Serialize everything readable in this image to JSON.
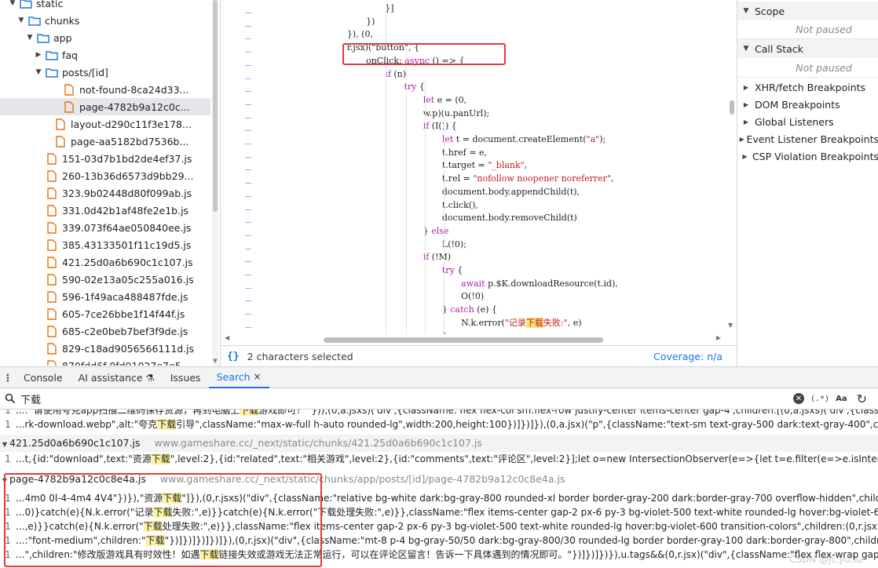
{
  "file_tree": {
    "items": [
      {
        "label": "static",
        "type": "folder",
        "expanded": true,
        "depth": 3
      },
      {
        "label": "chunks",
        "type": "folder",
        "expanded": true,
        "depth": 4
      },
      {
        "label": "app",
        "type": "folder",
        "expanded": true,
        "depth": 5
      },
      {
        "label": "faq",
        "type": "folder",
        "expanded": false,
        "depth": 6
      },
      {
        "label": "posts/[id]",
        "type": "folder",
        "expanded": true,
        "depth": 6
      },
      {
        "label": "not-found-8ca24d33...",
        "type": "file",
        "depth": 8
      },
      {
        "label": "page-4782b9a12c0c...",
        "type": "file",
        "depth": 8,
        "selected": true
      },
      {
        "label": "layout-d290c11f3e178...",
        "type": "file",
        "depth": 7
      },
      {
        "label": "page-aa5182bd7536b...",
        "type": "file",
        "depth": 7
      },
      {
        "label": "151-03d7b1bd2de4ef37.js",
        "type": "file",
        "depth": 6
      },
      {
        "label": "260-13b36d6573d9bb29...",
        "type": "file",
        "depth": 6
      },
      {
        "label": "323.9b02448d80f099ab.js",
        "type": "file",
        "depth": 6
      },
      {
        "label": "331.0d42b1af48fe2e1b.js",
        "type": "file",
        "depth": 6
      },
      {
        "label": "339.073f64ae050840ee.js",
        "type": "file",
        "depth": 6
      },
      {
        "label": "385.43133501f11c19d5.js",
        "type": "file",
        "depth": 6
      },
      {
        "label": "421.25d0a6b690c1c107.js",
        "type": "file",
        "depth": 6
      },
      {
        "label": "590-02e13a05c255a016.js",
        "type": "file",
        "depth": 6
      },
      {
        "label": "596-1f49aca488487fde.js",
        "type": "file",
        "depth": 6
      },
      {
        "label": "605-7ce26bbe1f14f44f.js",
        "type": "file",
        "depth": 6
      },
      {
        "label": "685-c2e0beb7bef3f9de.js",
        "type": "file",
        "depth": 6
      },
      {
        "label": "829-c18ad9056566111d.js",
        "type": "file",
        "depth": 6
      },
      {
        "label": "870fdd6f-0fd91027e7e5...",
        "type": "file",
        "depth": 6
      }
    ]
  },
  "editor": {
    "lines": [
      {
        "indent": 26,
        "tokens": [
          {
            "t": "}]"
          }
        ]
      },
      {
        "indent": 22,
        "tokens": [
          {
            "t": "})"
          }
        ]
      },
      {
        "indent": 18,
        "tokens": [
          {
            "t": "}), (0,"
          }
        ]
      },
      {
        "indent": 18,
        "tokens": [
          {
            "t": "r.jsx)(\"button\", {"
          }
        ]
      },
      {
        "indent": 22,
        "tokens": [
          {
            "t": "onClick: "
          },
          {
            "t": "async",
            "c": "kw"
          },
          {
            "t": " () => {"
          }
        ]
      },
      {
        "indent": 26,
        "tokens": [
          {
            "t": "if",
            "c": "kw"
          },
          {
            "t": " (n)"
          }
        ]
      },
      {
        "indent": 30,
        "tokens": [
          {
            "t": "try",
            "c": "kw"
          },
          {
            "t": " {"
          }
        ]
      },
      {
        "indent": 34,
        "tokens": [
          {
            "t": "let",
            "c": "kw"
          },
          {
            "t": " e = (0,"
          }
        ]
      },
      {
        "indent": 34,
        "tokens": [
          {
            "t": "w.p)(u.panUrl);"
          }
        ]
      },
      {
        "indent": 34,
        "tokens": [
          {
            "t": "if",
            "c": "kw"
          },
          {
            "t": " (I()) {"
          }
        ]
      },
      {
        "indent": 38,
        "tokens": [
          {
            "t": "let",
            "c": "kw"
          },
          {
            "t": " t = document.createElement("
          },
          {
            "t": "\"a\"",
            "c": "str"
          },
          {
            "t": ");"
          }
        ]
      },
      {
        "indent": 38,
        "tokens": [
          {
            "t": "t.href = e,"
          }
        ]
      },
      {
        "indent": 38,
        "tokens": [
          {
            "t": "t.target = "
          },
          {
            "t": "\"_blank\"",
            "c": "str"
          },
          {
            "t": ","
          }
        ]
      },
      {
        "indent": 38,
        "tokens": [
          {
            "t": "t.rel = "
          },
          {
            "t": "\"nofollow noopener noreferrer\"",
            "c": "str"
          },
          {
            "t": ","
          }
        ]
      },
      {
        "indent": 38,
        "tokens": [
          {
            "t": "document.body.appendChild(t),"
          }
        ]
      },
      {
        "indent": 38,
        "tokens": [
          {
            "t": "t.click(),"
          }
        ]
      },
      {
        "indent": 38,
        "tokens": [
          {
            "t": "document.body.removeChild(t)"
          }
        ]
      },
      {
        "indent": 34,
        "tokens": [
          {
            "t": "} "
          },
          {
            "t": "else",
            "c": "kw"
          }
        ]
      },
      {
        "indent": 38,
        "tokens": [
          {
            "t": "L(!0);"
          }
        ]
      },
      {
        "indent": 34,
        "tokens": [
          {
            "t": "if",
            "c": "kw"
          },
          {
            "t": " (!M)"
          }
        ]
      },
      {
        "indent": 38,
        "tokens": [
          {
            "t": "try",
            "c": "kw"
          },
          {
            "t": " {"
          }
        ]
      },
      {
        "indent": 42,
        "tokens": [
          {
            "t": "await",
            "c": "kw"
          },
          {
            "t": " p.$K.downloadResource(t.id),"
          }
        ]
      },
      {
        "indent": 42,
        "tokens": [
          {
            "t": "O(!0)"
          }
        ]
      },
      {
        "indent": 38,
        "tokens": [
          {
            "t": "} "
          },
          {
            "t": "catch",
            "c": "kw"
          },
          {
            "t": " (e) {"
          }
        ]
      },
      {
        "indent": 42,
        "tokens": [
          {
            "t": "N.k.error("
          },
          {
            "t": "\"记录",
            "c": "str"
          },
          {
            "t": "下载",
            "c": "str-hl"
          },
          {
            "t": "失败:\"",
            "c": "str"
          },
          {
            "t": ", e)"
          }
        ]
      },
      {
        "indent": 38,
        "tokens": [
          {
            "t": "}"
          }
        ]
      }
    ],
    "status": {
      "braces": "{}",
      "selection": "2 characters selected",
      "coverage": "Coverage: n/a"
    }
  },
  "debugger": {
    "sections": [
      {
        "label": "Scope",
        "expanded": true,
        "note": "Not paused"
      },
      {
        "label": "Call Stack",
        "expanded": true,
        "note": "Not paused"
      }
    ],
    "items": [
      "XHR/fetch Breakpoints",
      "DOM Breakpoints",
      "Global Listeners",
      "Event Listener Breakpoints",
      "CSP Violation Breakpoints"
    ]
  },
  "drawer": {
    "kebab": "⋮",
    "tabs": [
      {
        "label": "Console",
        "active": false
      },
      {
        "label": "AI assistance ⚗",
        "active": false
      },
      {
        "label": "Issues",
        "active": false
      },
      {
        "label": "Search",
        "active": true,
        "closable": true
      }
    ],
    "close_glyph": "×"
  },
  "search": {
    "query": "下载",
    "regex_label": "(.*)",
    "case_label": "Aa",
    "refresh_glyph": "↻"
  },
  "results": {
    "groups": [
      {
        "file": null,
        "lines": [
          {
            "num": "1",
            "before": "...: '请使用夸克app扫描二维码保存资源，再到电脑上",
            "match": "下载",
            "after": "游戏即可！' })),(0,a.jsxs)('div',{className:'flex flex-col sm:flex-row justify-center items-center gap-4',children:[(0,a.jsxs)('div',{className:'"
          },
          {
            "num": "1",
            "before": "...rk-download.webp\",alt:\"夸克",
            "match": "下载",
            "after": "引导\",className:\"max-w-full h-auto rounded-lg\",width:200,height:100})]})]}),(0,a.jsx)(\"p\",{className:\"text-sm text-gray-500 dark:text-gray-400\",children:\"温馨提"
          }
        ]
      },
      {
        "file": "421.25d0a6b690c1c107.js",
        "url": "www.gameshare.cc/_next/static/chunks/421.25d0a6b690c1c107.js",
        "lines": [
          {
            "num": "1",
            "before": "...t,{id:\"download\",text:\"资源",
            "match": "下载",
            "after": "\",level:2},{id:\"related\",text:\"相关游戏\",level:2},{id:\"comments\",text:\"评论区\",level:2}];let o=new IntersectionObserver(e=>{let t=e.filter(e=>e.isIntersecting).map(e=>"
          }
        ]
      },
      {
        "file": "page-4782b9a12c0c8e4a.js",
        "url": "www.gameshare.cc/_next/static/chunks/app/posts/[id]/page-4782b9a12c0c8e4a.js",
        "lines": [
          {
            "num": "1",
            "before": "...4m0 0l-4-4m4 4V4\"})}),\"资源",
            "match": "下载",
            "after": "\"]}),(0,r.jsxs)(\"div\",{className:\"relative bg-white dark:bg-gray-800 rounded-xl border border-gray-200 dark:border-gray-700 overflow-hidden\",children:[(0,r.jsx)("
          },
          {
            "num": "1",
            "before": "...0)}catch(e){N.k.error(\"记录",
            "match": "下载",
            "after": "失败:\",e)}}catch(e){N.k.error(\"下载处理失败:\",e)}},className:\"flex items-center gap-2 px-6 py-3 bg-violet-500 text-white rounded-lg hover:bg-violet-600 transition"
          },
          {
            "num": "1",
            "before": "...,e)}}catch(e){N.k.error(\"",
            "match": "下载",
            "after": "处理失败:\",e)}},className:\"flex items-center gap-2 px-6 py-3 bg-violet-500 text-white rounded-lg hover:bg-violet-600 transition-colors\",children:(0,r.jsx)(\"span\",{className:"
          },
          {
            "num": "1",
            "before": "...:\"font-medium\",children:\"",
            "match": "下载",
            "after": "\"})]})]})]})]}),(0,r.jsx)(\"div\",{className:\"mt-8 p-4 bg-gray-50/50 dark:bg-gray-800/30 rounded-lg border border-gray-100 dark:border-gray-800\",children:(0,r.jsx)("
          },
          {
            "num": "1",
            "before": "...\",children:\"修改版游戏具有时效性！如遇",
            "match": "下载",
            "after": "链接失效或游戏无法正常运行，可以在评论区留言！告诉一下具体遇到的情况即可。\"})]})]})}),u.tags&&(0,r.jsx)(\"div\",{className:\"flex flex-wrap gap-2 mt-8"
          }
        ]
      }
    ]
  },
  "watermark": "CSDN @jc.jiu.lu",
  "colors": {
    "accent": "#1a73e8",
    "folder": "#1a73e8",
    "file": "#e8710a",
    "highlight_box": "#e53935",
    "match_bg": "#fdf1a5"
  }
}
